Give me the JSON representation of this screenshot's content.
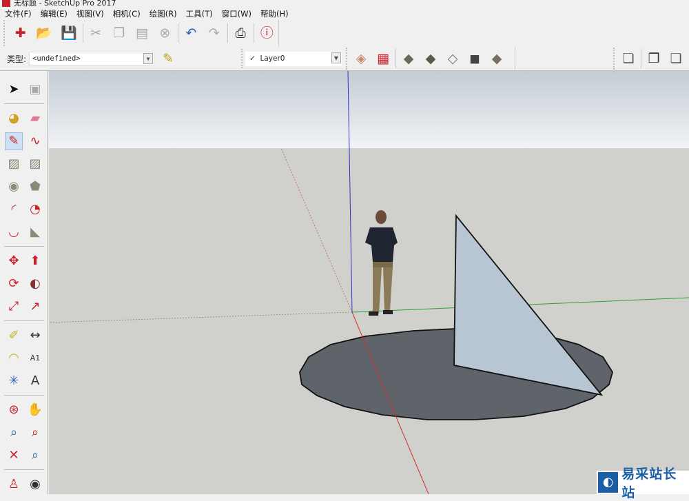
{
  "window": {
    "title": "无标题 - SketchUp Pro 2017"
  },
  "menu": [
    "文件(F)",
    "编辑(E)",
    "视图(V)",
    "相机(C)",
    "绘图(R)",
    "工具(T)",
    "窗口(W)",
    "帮助(H)"
  ],
  "standard_toolbar": [
    {
      "name": "new-icon",
      "glyph": "✚",
      "color": "#c8202a"
    },
    {
      "name": "open-icon",
      "glyph": "📂",
      "color": "#7a6a3a"
    },
    {
      "name": "save-icon",
      "glyph": "💾",
      "color": "#2b63b0"
    },
    {
      "sep": true
    },
    {
      "name": "cut-icon",
      "glyph": "✂",
      "color": "#aaaaaa"
    },
    {
      "name": "copy-icon",
      "glyph": "❐",
      "color": "#aaaaaa"
    },
    {
      "name": "paste-icon",
      "glyph": "▤",
      "color": "#aaaaaa"
    },
    {
      "name": "erase-icon",
      "glyph": "⊗",
      "color": "#aaaaaa"
    },
    {
      "sep": true
    },
    {
      "name": "undo-icon",
      "glyph": "↶",
      "color": "#2b63b0"
    },
    {
      "name": "redo-icon",
      "glyph": "↷",
      "color": "#aaaaaa"
    },
    {
      "sep": true
    },
    {
      "name": "print-icon",
      "glyph": "⎙",
      "color": "#333333"
    },
    {
      "sep": true
    },
    {
      "name": "model-info-icon",
      "glyph": "ⓘ",
      "color": "#c8202a"
    }
  ],
  "entity_info": {
    "label": "类型:",
    "value": "<undefined>"
  },
  "layers": {
    "check": "✓",
    "value": "Layer0"
  },
  "section_toolbar": [
    {
      "name": "section-plane-icon",
      "glyph": "◈",
      "color": "#c98a6a"
    },
    {
      "name": "section-fill-icon",
      "glyph": "▦",
      "color": "#d0202a"
    },
    {
      "sep": true
    },
    {
      "name": "sandbox-smoove-icon",
      "glyph": "◆",
      "color": "#6a6a5a"
    },
    {
      "name": "sandbox-stamp-icon",
      "glyph": "◆",
      "color": "#5a5a4a"
    },
    {
      "name": "sandbox-drape-icon",
      "glyph": "◇",
      "color": "#777777"
    },
    {
      "name": "sandbox-add-detail-icon",
      "glyph": "◼",
      "color": "#444444"
    },
    {
      "name": "sandbox-flip-edge-icon",
      "glyph": "◆",
      "color": "#777060"
    }
  ],
  "style_toolbar": [
    {
      "name": "style-xray-icon",
      "glyph": "❏",
      "color": "#555555"
    },
    {
      "sep": true
    },
    {
      "name": "style-wireframe-icon",
      "glyph": "❐",
      "color": "#333333"
    },
    {
      "name": "style-hidden-line-icon",
      "glyph": "❏",
      "color": "#555555"
    }
  ],
  "left_tools": [
    [
      {
        "name": "select-icon",
        "glyph": "➤",
        "color": "#111111"
      },
      {
        "name": "make-component-icon",
        "glyph": "▣",
        "color": "#aaaaaa"
      }
    ],
    "sep",
    [
      {
        "name": "paint-bucket-icon",
        "glyph": "◕",
        "color": "#d0a020"
      },
      {
        "name": "eraser-icon",
        "glyph": "▰",
        "color": "#e07890"
      }
    ],
    [
      {
        "name": "pencil-icon",
        "glyph": "✎",
        "color": "#c8202a",
        "selected": true
      },
      {
        "name": "freehand-icon",
        "glyph": "∿",
        "color": "#c8202a"
      }
    ],
    [
      {
        "name": "rectangle-icon",
        "glyph": "▨",
        "color": "#8a8a78"
      },
      {
        "name": "rotated-rectangle-icon",
        "glyph": "▨",
        "color": "#8a8a78"
      }
    ],
    [
      {
        "name": "circle-icon",
        "glyph": "◉",
        "color": "#8a8a78"
      },
      {
        "name": "polygon-icon",
        "glyph": "⬟",
        "color": "#8a8a78"
      }
    ],
    [
      {
        "name": "arc-icon",
        "glyph": "◜",
        "color": "#c8202a"
      },
      {
        "name": "pie-icon",
        "glyph": "◔",
        "color": "#c8202a"
      }
    ],
    [
      {
        "name": "two-point-arc-icon",
        "glyph": "◡",
        "color": "#c8202a"
      },
      {
        "name": "three-point-arc-icon",
        "glyph": "◣",
        "color": "#8a8a78"
      }
    ],
    "sep",
    [
      {
        "name": "move-icon",
        "glyph": "✥",
        "color": "#c8202a"
      },
      {
        "name": "push-pull-icon",
        "glyph": "⬆",
        "color": "#c8202a"
      }
    ],
    [
      {
        "name": "rotate-icon",
        "glyph": "⟳",
        "color": "#c8202a"
      },
      {
        "name": "follow-me-icon",
        "glyph": "◐",
        "color": "#8a3030"
      }
    ],
    [
      {
        "name": "scale-icon",
        "glyph": "⤢",
        "color": "#c8202a"
      },
      {
        "name": "offset-icon",
        "glyph": "↗",
        "color": "#c8202a"
      }
    ],
    "sep",
    [
      {
        "name": "tape-measure-icon",
        "glyph": "✐",
        "color": "#c0b020"
      },
      {
        "name": "dimension-icon",
        "glyph": "↔",
        "color": "#333333"
      }
    ],
    [
      {
        "name": "protractor-icon",
        "glyph": "◠",
        "color": "#c0b020"
      },
      {
        "name": "text-icon",
        "glyph": "A1",
        "color": "#333333"
      }
    ],
    [
      {
        "name": "axes-icon",
        "glyph": "✳",
        "color": "#3060c0"
      },
      {
        "name": "3d-text-icon",
        "glyph": "A",
        "color": "#333333"
      }
    ],
    "sep",
    [
      {
        "name": "orbit-icon",
        "glyph": "⊛",
        "color": "#c8202a"
      },
      {
        "name": "pan-icon",
        "glyph": "✋",
        "color": "#d8c080"
      }
    ],
    [
      {
        "name": "zoom-icon",
        "glyph": "⌕",
        "color": "#2b63b0"
      },
      {
        "name": "zoom-window-icon",
        "glyph": "⌕",
        "color": "#c8202a"
      }
    ],
    [
      {
        "name": "zoom-extents-icon",
        "glyph": "✕",
        "color": "#c8202a"
      },
      {
        "name": "previous-view-icon",
        "glyph": "⌕",
        "color": "#2b63b0"
      }
    ],
    "sep",
    [
      {
        "name": "position-camera-icon",
        "glyph": "♙",
        "color": "#c8202a"
      },
      {
        "name": "look-around-icon",
        "glyph": "◉",
        "color": "#333333"
      }
    ]
  ],
  "colors": {
    "sky_top": "#c4ccd4",
    "sky_bottom": "#f2f4f6",
    "ground": "#d0d0cc",
    "shadow": "#5f636a",
    "triangle": "#b8c6d4",
    "axis_red": "#d03030",
    "axis_green": "#30a030",
    "axis_blue": "#3030c8"
  },
  "watermark": {
    "text": "易采站长站"
  }
}
